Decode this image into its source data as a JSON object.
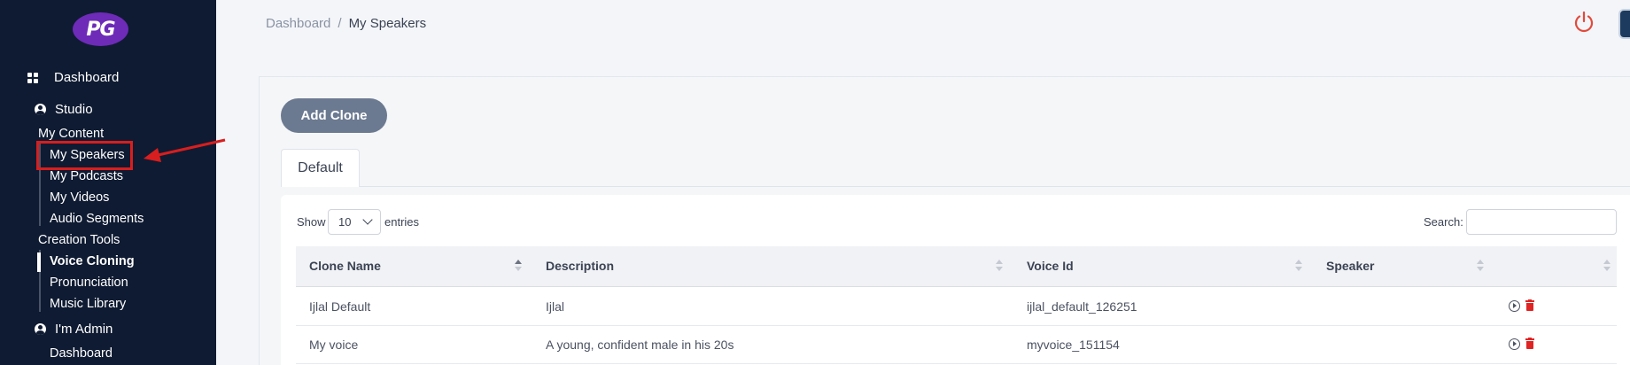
{
  "sidebar": {
    "logo_text": "PG",
    "dashboard": "Dashboard",
    "studio": "Studio",
    "my_content": "My Content",
    "my_speakers": "My Speakers",
    "my_podcasts": "My Podcasts",
    "my_videos": "My Videos",
    "audio_segments": "Audio Segments",
    "creation_tools": "Creation Tools",
    "voice_cloning": "Voice Cloning",
    "pronunciation": "Pronunciation",
    "music_library": "Music Library",
    "im_admin": "I'm Admin",
    "admin_dashboard": "Dashboard"
  },
  "breadcrumb": {
    "root": "Dashboard",
    "separator": "/",
    "current": "My Speakers"
  },
  "toolbar": {
    "add_clone_label": "Add Clone"
  },
  "tabs": [
    {
      "label": "Default",
      "active": true
    }
  ],
  "table_controls": {
    "show_label": "Show",
    "entries_value": "10",
    "entries_label": "entries",
    "search_label": "Search:",
    "search_value": ""
  },
  "table": {
    "columns": [
      "Clone Name",
      "Description",
      "Voice Id",
      "Speaker",
      ""
    ],
    "rows": [
      {
        "clone_name": "Ijlal Default",
        "description": "Ijlal",
        "voice_id": "ijlal_default_126251",
        "speaker": ""
      },
      {
        "clone_name": "My voice",
        "description": "A young, confident male in his 20s",
        "voice_id": "myvoice_151154",
        "speaker": ""
      }
    ]
  },
  "colors": {
    "sidebar_bg": "#0f1b32",
    "logo_purple": "#6d2bb8",
    "annotation_red": "#d81e1e",
    "button_bg": "#6c7a91",
    "power_red": "#e24a3b",
    "delete_red": "#e02424"
  },
  "icons": {
    "dashboard": "dashboard-grid-icon",
    "studio": "user-circle-icon",
    "admin": "user-circle-icon",
    "power": "power-icon",
    "play": "play-circle-icon",
    "delete": "trash-icon"
  }
}
